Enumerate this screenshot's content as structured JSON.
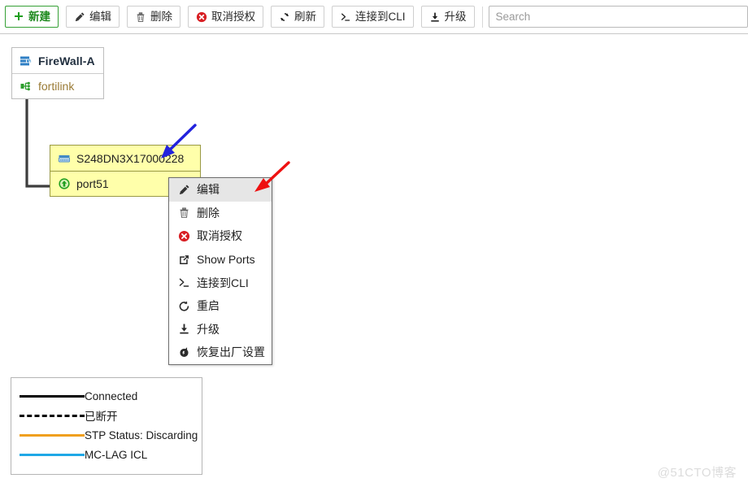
{
  "toolbar": {
    "buttons": [
      {
        "label": "新建",
        "icon": "plus-icon",
        "primary": true
      },
      {
        "label": "编辑",
        "icon": "pencil-icon",
        "primary": false
      },
      {
        "label": "删除",
        "icon": "trash-icon",
        "primary": false
      },
      {
        "label": "取消授权",
        "icon": "deauthorize-icon",
        "primary": false
      },
      {
        "label": "刷新",
        "icon": "refresh-icon",
        "primary": false
      },
      {
        "label": "连接到CLI",
        "icon": "cli-prompt-icon",
        "primary": false
      },
      {
        "label": "升级",
        "icon": "upgrade-icon",
        "primary": false
      }
    ],
    "search": {
      "name": "search-input",
      "placeholder": "Search",
      "value": ""
    }
  },
  "topology": {
    "firewall_node": {
      "device_name": "FireWall-A",
      "device_icon": "firewall-icon",
      "port_name": "fortilink",
      "port_icon": "fortilink-icon"
    },
    "switch_node": {
      "device_name": "S248DN3X17000228",
      "device_icon": "switch-icon",
      "port_name": "port51",
      "port_icon": "port-up-arrow-icon",
      "selected": true,
      "highlight_color": "#ffffaa"
    },
    "link_color": "#3d3d3d"
  },
  "context_menu": {
    "items": [
      {
        "label": "编辑",
        "icon": "pencil-icon",
        "active": true
      },
      {
        "label": "删除",
        "icon": "trash-icon",
        "active": false
      },
      {
        "label": "取消授权",
        "icon": "deauthorize-icon",
        "active": false
      },
      {
        "label": "Show Ports",
        "icon": "external-link-icon",
        "active": false
      },
      {
        "label": "连接到CLI",
        "icon": "cli-prompt-icon",
        "active": false
      },
      {
        "label": "重启",
        "icon": "restart-icon",
        "active": false
      },
      {
        "label": "升级",
        "icon": "upgrade-icon",
        "active": false
      },
      {
        "label": "恢复出厂设置",
        "icon": "factory-reset-icon",
        "active": false
      }
    ]
  },
  "legend": {
    "items": [
      {
        "label": "Connected",
        "color": "#000000",
        "style": "solid"
      },
      {
        "label": "已断开",
        "color": "#000000",
        "style": "dashed"
      },
      {
        "label": "STP Status: Discarding",
        "color": "#f0a01e",
        "style": "solid"
      },
      {
        "label": "MC-LAG ICL",
        "color": "#1fa8e6",
        "style": "solid"
      }
    ]
  },
  "annotations": {
    "arrows": [
      {
        "name": "blue-arrow-pointing-to-switch-name",
        "color": "#2222dd"
      },
      {
        "name": "red-arrow-pointing-to-edit-menu-item",
        "color": "#ee1111"
      }
    ]
  },
  "watermark": {
    "text": "@51CTO博客"
  }
}
